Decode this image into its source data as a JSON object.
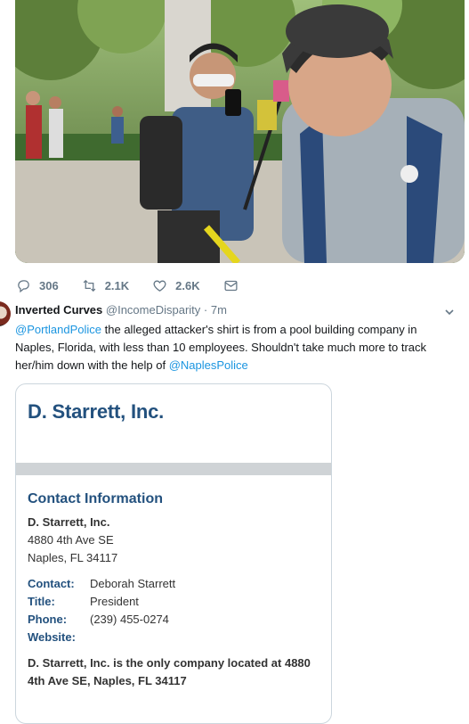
{
  "actions": {
    "reply_count": "306",
    "retweet_count": "2.1K",
    "like_count": "2.6K"
  },
  "reply": {
    "author_name": "Inverted Curves",
    "author_handle": "@IncomeDisparity",
    "separator": "·",
    "time": "7m",
    "mention_1": "@PortlandPolice",
    "text_1": " the alleged attacker's shirt is from a pool building company in Naples,  Florida, with less than 10 employees.  Shouldn't take much more to track her/him down with the help of ",
    "mention_2": "@NaplesPolice"
  },
  "card": {
    "title": "D. Starrett, Inc.",
    "section_title": "Contact Information",
    "company": "D. Starrett, Inc.",
    "address_line1": "4880 4th Ave SE",
    "address_line2": "Naples, FL 34117",
    "fields": [
      {
        "key": "Contact:",
        "value": "Deborah Starrett"
      },
      {
        "key": "Title:",
        "value": "President"
      },
      {
        "key": "Phone:",
        "value": "(239) 455-0274"
      },
      {
        "key": "Website:",
        "value": ""
      }
    ],
    "note": "D. Starrett, Inc. is the only company located at 4880 4th Ave SE, Naples, FL 34117"
  },
  "icons": {
    "reply": "reply-icon",
    "retweet": "retweet-icon",
    "like": "heart-icon",
    "dm": "envelope-icon",
    "caret": "chevron-down-icon"
  },
  "colors": {
    "link": "#1b95e0",
    "muted": "#657786",
    "card_heading": "#23517e"
  }
}
